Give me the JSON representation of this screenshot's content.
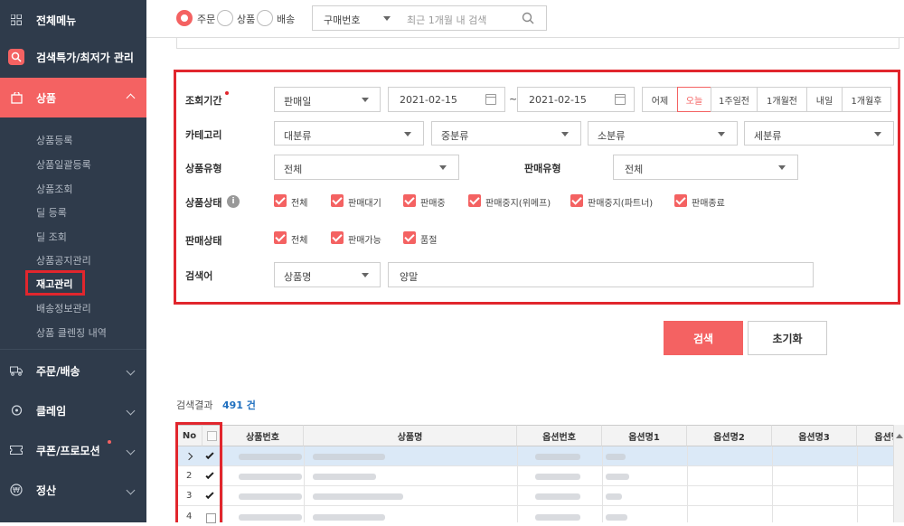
{
  "sidebar": {
    "menu_all": "전체메뉴",
    "search_special": "검색특가/최저가 관리",
    "product": "상품",
    "subitems": [
      "상품등록",
      "상품일괄등록",
      "상품조회",
      "딜 등록",
      "딜 조회",
      "상품공지관리",
      "재고관리",
      "배송정보관리",
      "상품 클렌징 내역"
    ],
    "order": "주문/배송",
    "claim": "클레임",
    "coupon": "쿠폰/프로모션",
    "settle": "정산"
  },
  "topbar": {
    "radios": [
      "주문",
      "상품",
      "배송"
    ],
    "search_type": "구매번호",
    "search_placeholder": "최근 1개월 내 검색"
  },
  "filters": {
    "period_label": "조회기간",
    "period_type": "판매일",
    "date_from": "2021-02-15",
    "date_sep": "~",
    "date_to": "2021-02-15",
    "quick": [
      "어제",
      "오늘",
      "1주일전",
      "1개월전",
      "내일",
      "1개월후"
    ],
    "category_label": "카테고리",
    "categories": [
      "대분류",
      "중분류",
      "소분류",
      "세분류"
    ],
    "ptype_label": "상품유형",
    "ptype_value": "전체",
    "stype_label": "판매유형",
    "stype_value": "전체",
    "pstatus_label": "상품상태",
    "pstatus": [
      "전체",
      "판매대기",
      "판매중",
      "판매중지(위메프)",
      "판매중지(파트너)",
      "판매종료"
    ],
    "sstatus_label": "판매상태",
    "sstatus": [
      "전체",
      "판매가능",
      "품절"
    ],
    "keyword_label": "검색어",
    "keyword_type": "상품명",
    "keyword_value": "양말"
  },
  "buttons": {
    "search": "검색",
    "reset": "초기화"
  },
  "results": {
    "label": "검색결과",
    "count": "491 건"
  },
  "table": {
    "headers": [
      "No",
      "상품번호",
      "상품명",
      "옵션번호",
      "옵션명1",
      "옵션명2",
      "옵션명3",
      "옵션명"
    ],
    "rows": [
      "",
      "2",
      "3",
      "4"
    ]
  },
  "colors": {
    "accent": "#f46262",
    "highlight": "#e1262d",
    "sidebar": "#2f3b4b",
    "link": "#1f6fbf"
  }
}
